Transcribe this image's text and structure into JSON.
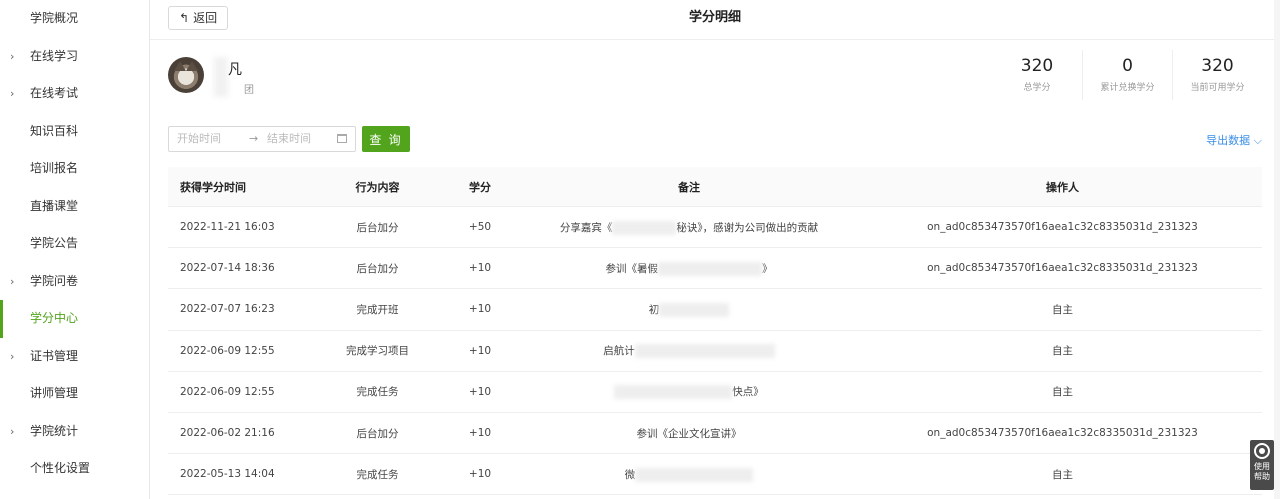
{
  "sidebar": {
    "items": [
      {
        "label": "学院概况",
        "expandable": false,
        "active": false
      },
      {
        "label": "在线学习",
        "expandable": true,
        "active": false
      },
      {
        "label": "在线考试",
        "expandable": true,
        "active": false
      },
      {
        "label": "知识百科",
        "expandable": false,
        "active": false
      },
      {
        "label": "培训报名",
        "expandable": false,
        "active": false
      },
      {
        "label": "直播课堂",
        "expandable": false,
        "active": false
      },
      {
        "label": "学院公告",
        "expandable": false,
        "active": false
      },
      {
        "label": "学院问卷",
        "expandable": true,
        "active": false
      },
      {
        "label": "学分中心",
        "expandable": false,
        "active": true
      },
      {
        "label": "证书管理",
        "expandable": true,
        "active": false
      },
      {
        "label": "讲师管理",
        "expandable": false,
        "active": false
      },
      {
        "label": "学院统计",
        "expandable": true,
        "active": false
      },
      {
        "label": "个性化设置",
        "expandable": false,
        "active": false
      }
    ]
  },
  "header": {
    "back_label": "返回",
    "title": "学分明细"
  },
  "user": {
    "name_visible": "凡",
    "dept_visible": "团"
  },
  "stats": [
    {
      "value": "320",
      "label": "总学分"
    },
    {
      "value": "0",
      "label": "累计兑换学分"
    },
    {
      "value": "320",
      "label": "当前可用学分"
    }
  ],
  "filter": {
    "start_placeholder": "开始时间",
    "end_placeholder": "结束时间",
    "query_label": "查 询",
    "export_label": "导出数据"
  },
  "table": {
    "headers": [
      "获得学分时间",
      "行为内容",
      "学分",
      "备注",
      "操作人"
    ],
    "rows": [
      {
        "time": "2022-11-21 16:03",
        "action": "后台加分",
        "credit": "+50",
        "note_prefix": "分享嘉宾《",
        "note_suffix": "秘诀》，感谢为公司做出的贡献",
        "operator": "on_ad0c853473570f16aea1c32c8335031d_231323"
      },
      {
        "time": "2022-07-14 18:36",
        "action": "后台加分",
        "credit": "+10",
        "note_prefix": "参训《暑假",
        "note_suffix": "》",
        "operator": "on_ad0c853473570f16aea1c32c8335031d_231323"
      },
      {
        "time": "2022-07-07 16:23",
        "action": "完成开班",
        "credit": "+10",
        "note_prefix": "初",
        "note_suffix": "",
        "operator": "自主"
      },
      {
        "time": "2022-06-09 12:55",
        "action": "完成学习项目",
        "credit": "+10",
        "note_prefix": "启航计",
        "note_suffix": "",
        "operator": "自主"
      },
      {
        "time": "2022-06-09 12:55",
        "action": "完成任务",
        "credit": "+10",
        "note_prefix": "",
        "note_suffix": "快点》",
        "operator": "自主"
      },
      {
        "time": "2022-06-02 21:16",
        "action": "后台加分",
        "credit": "+10",
        "note_prefix": "参训《企业文化宣讲》",
        "note_suffix": "",
        "operator": "on_ad0c853473570f16aea1c32c8335031d_231323"
      },
      {
        "time": "2022-05-13 14:04",
        "action": "完成任务",
        "credit": "+10",
        "note_prefix": "微",
        "note_suffix": "",
        "operator": "自主"
      }
    ]
  },
  "help": {
    "line1": "使用",
    "line2": "帮助"
  },
  "colors": {
    "accent": "#52a41c",
    "link": "#3a8ee6"
  }
}
